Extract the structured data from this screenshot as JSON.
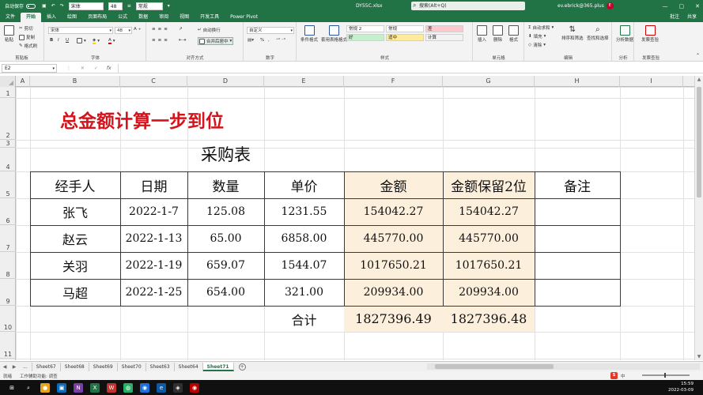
{
  "titlebar": {
    "autosave_label": "自动保存",
    "font_box": "宋体",
    "size_box": "48",
    "format_box": "常规",
    "filename": "DY55C.xlsx",
    "search_placeholder": "搜索(Alt+Q)",
    "user": "ev.ebrick@365.plus",
    "user_badge": "E",
    "min": "—",
    "max": "▢",
    "close": "✕"
  },
  "tabs": {
    "items": [
      "文件",
      "开始",
      "插入",
      "绘图",
      "页面布局",
      "公式",
      "数据",
      "审阅",
      "视图",
      "开发工具",
      "Power Pivot"
    ],
    "active": "开始",
    "comment": "批注",
    "share": "共享"
  },
  "ribbon": {
    "clipboard": {
      "label": "剪贴板",
      "paste": "粘贴",
      "cut": "剪切",
      "copy": "复制",
      "painter": "格式刷"
    },
    "font": {
      "label": "字体",
      "name": "宋体",
      "size": "48",
      "bold": "B",
      "italic": "I",
      "underline": "U"
    },
    "align": {
      "label": "对齐方式",
      "wrap": "自动换行",
      "merge": "合并后居中"
    },
    "number": {
      "label": "数字",
      "format": "自定义",
      "percent": "%",
      "comma": ","
    },
    "styles": {
      "label": "样式",
      "cond": "条件格式",
      "table": "套用表格格式",
      "cells": [
        {
          "text": "常规 2",
          "bg": "#ffffff"
        },
        {
          "text": "常规",
          "bg": "#ffffff"
        },
        {
          "text": "差",
          "bg": "#ffc7ce"
        },
        {
          "text": "好",
          "bg": "#c6efce"
        },
        {
          "text": "适中",
          "bg": "#ffeb9c"
        },
        {
          "text": "计算",
          "bg": "#f2f2f2"
        }
      ]
    },
    "cells": {
      "label": "单元格",
      "insert": "插入",
      "delete": "删除",
      "format": "格式"
    },
    "editing": {
      "label": "编辑",
      "sum": "自动求和",
      "fill": "填充",
      "clear": "清除",
      "sort": "排序和筛选",
      "find": "查找和选择"
    },
    "analysis": {
      "label": "分析",
      "btn": "分析数据"
    },
    "invoice": {
      "label": "发票查验",
      "btn": "发票查验"
    }
  },
  "formula_bar": {
    "namebox": "E2",
    "separator": "⋮ ✕ ✓",
    "fx": "fx",
    "content": ""
  },
  "columns": [
    "A",
    "B",
    "C",
    "D",
    "E",
    "F",
    "G",
    "H",
    "I"
  ],
  "rows": [
    "1",
    "2",
    "3",
    "4",
    "5",
    "6",
    "7",
    "8",
    "9",
    "10",
    "11"
  ],
  "sheet": {
    "big_title": "总金额计算一步到位",
    "table_title": "采购表",
    "headers": [
      "经手人",
      "日期",
      "数量",
      "单价",
      "金额",
      "金额保留2位",
      "备注"
    ],
    "data": [
      [
        "张飞",
        "2022-1-7",
        "125.08",
        "1231.55",
        "154042.27",
        "154042.27",
        ""
      ],
      [
        "赵云",
        "2022-1-13",
        "65.00",
        "6858.00",
        "445770.00",
        "445770.00",
        ""
      ],
      [
        "关羽",
        "2022-1-19",
        "659.07",
        "1544.07",
        "1017650.21",
        "1017650.21",
        ""
      ],
      [
        "马超",
        "2022-1-25",
        "654.00",
        "321.00",
        "209934.00",
        "209934.00",
        ""
      ]
    ],
    "total_label": "合计",
    "total_amount": "1827396.49",
    "total_rounded": "1827396.48",
    "title_color": "#d4141c",
    "shade_color": "#fcefdc"
  },
  "sheet_tabs": {
    "ellipsis": "...",
    "items": [
      "Sheet67",
      "Sheet68",
      "Sheet69",
      "Sheet70",
      "Sheet63",
      "Sheet64",
      "Sheet71"
    ],
    "active": "Sheet71",
    "add": "+"
  },
  "status": {
    "ready": "就绪",
    "accessibility": "工作辅助功能: 调查",
    "ime": "中",
    "ime_s": "S"
  },
  "taskbar": {
    "time": "15:59",
    "date": "2022-03-09"
  }
}
